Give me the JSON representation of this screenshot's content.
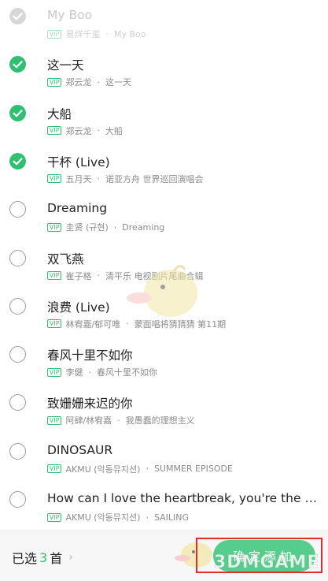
{
  "songs": [
    {
      "title": "My Boo",
      "vip": "VIP",
      "artist": "易烊千玺",
      "album": "My Boo",
      "checked": true,
      "faded": true
    },
    {
      "title": "这一天",
      "vip": "VIP",
      "artist": "郑云龙",
      "album": "这一天",
      "checked": true,
      "faded": false
    },
    {
      "title": "大船",
      "vip": "VIP",
      "artist": "郑云龙",
      "album": "大船",
      "checked": true,
      "faded": false
    },
    {
      "title": "干杯 (Live)",
      "vip": "VIP",
      "artist": "五月天",
      "album": "诺亚方舟 世界巡回演唱会",
      "checked": true,
      "faded": false
    },
    {
      "title": "Dreaming",
      "vip": "VIP",
      "artist": "圭贤 (규현)",
      "album": "Dreaming",
      "checked": false,
      "faded": false
    },
    {
      "title": "双飞燕",
      "vip": "VIP",
      "artist": "崔子格",
      "album": "清平乐 电视剧片尾曲合辑",
      "checked": false,
      "faded": false
    },
    {
      "title": "浪费 (Live)",
      "vip": "VIP",
      "artist": "林宥嘉/郁可唯",
      "album": "蒙面唱将猜猜猜 第11期",
      "checked": false,
      "faded": false
    },
    {
      "title": "春风十里不如你",
      "vip": "VIP",
      "artist": "李健",
      "album": "春风十里不如你",
      "checked": false,
      "faded": false
    },
    {
      "title": "致姗姗来迟的你",
      "vip": "VIP",
      "artist": "阿肆/林宥嘉",
      "album": "我愚蠢的理想主义",
      "checked": false,
      "faded": false
    },
    {
      "title": "DINOSAUR",
      "vip": "VIP",
      "artist": "AKMU (악동뮤지션)",
      "album": "SUMMER EPISODE",
      "checked": false,
      "faded": false
    },
    {
      "title": "How can I love the heartbreak, you're the one...",
      "vip": "VIP",
      "artist": "AKMU (악동뮤지션)",
      "album": "SAILING",
      "checked": false,
      "faded": false
    }
  ],
  "separator": "·",
  "footer": {
    "selected_prefix": "已选",
    "selected_count": "3",
    "selected_suffix": "首",
    "chevron": "›",
    "confirm_label": "确定添加"
  },
  "watermark": {
    "text": "3DMGAME"
  },
  "colors": {
    "accent": "#2fc071",
    "button": "#56cd8c",
    "highlight": "#e32b2b"
  },
  "icons": {
    "check": "check-icon",
    "chevron": "chevron-right-icon"
  }
}
